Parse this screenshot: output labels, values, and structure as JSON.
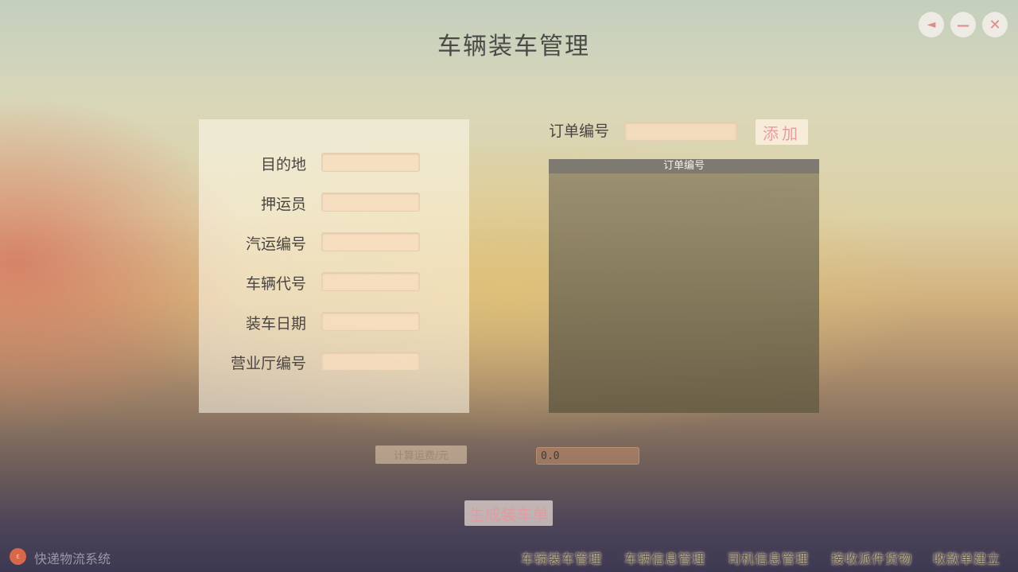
{
  "window": {
    "title": "车辆装车管理",
    "controls": {
      "back": "◄",
      "minimize": "—",
      "close": "✕"
    }
  },
  "form": {
    "fields": [
      {
        "label": "目的地",
        "value": ""
      },
      {
        "label": "押运员",
        "value": ""
      },
      {
        "label": "汽运编号",
        "value": ""
      },
      {
        "label": "车辆代号",
        "value": ""
      },
      {
        "label": "装车日期",
        "value": ""
      },
      {
        "label": "营业厅编号",
        "value": ""
      }
    ]
  },
  "order": {
    "label": "订单编号",
    "value": "",
    "add_button": "添加",
    "table_header": "订单编号",
    "rows": []
  },
  "fee": {
    "button": "计算运费/元",
    "value": "0.0"
  },
  "generate_button": "生成装车单",
  "footer": {
    "logo_text": "ε",
    "app_name": "快递物流系统",
    "nav": [
      "车辆装车管理",
      "车辆信息管理",
      "司机信息管理",
      "接收派件货物",
      "收款单建立"
    ]
  },
  "colors": {
    "accent_pink": "#e39aa0",
    "input_bg": "#f7ddbe",
    "logo": "#d9674a"
  }
}
